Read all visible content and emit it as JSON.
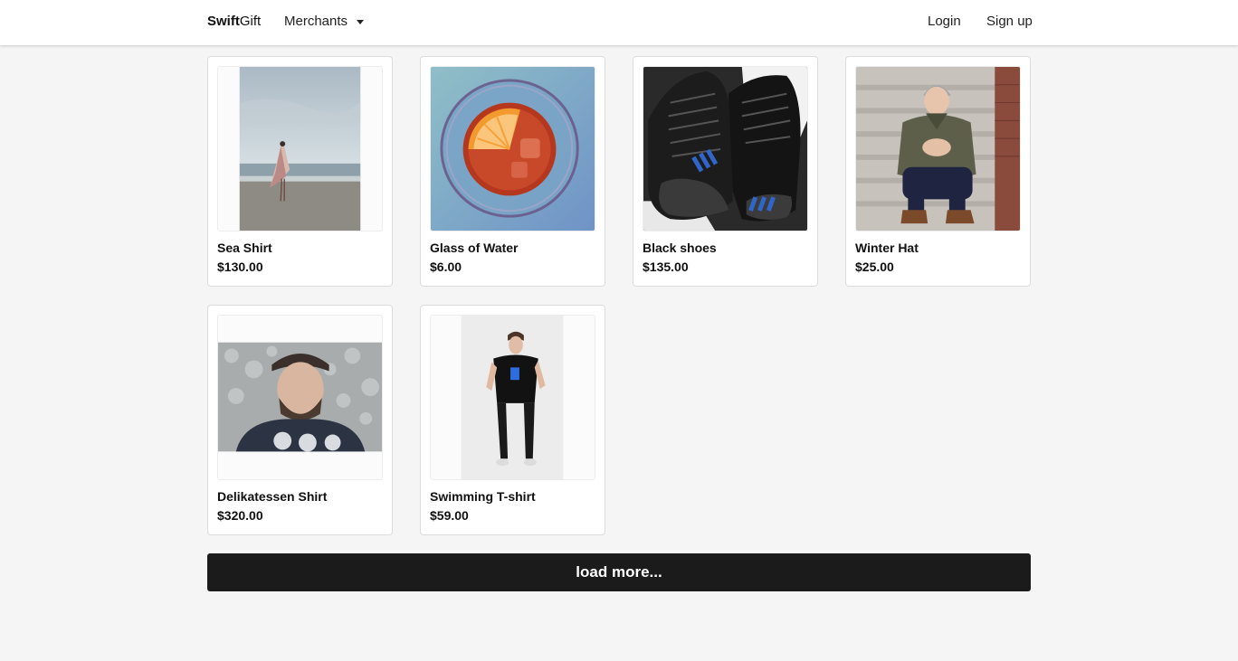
{
  "navbar": {
    "brand_bold": "Swift",
    "brand_rest": "Gift",
    "merchants_label": "Merchants",
    "login_label": "Login",
    "signup_label": "Sign up"
  },
  "products": [
    {
      "name": "Sea Shirt",
      "price": "$130.00"
    },
    {
      "name": "Glass of Water",
      "price": "$6.00"
    },
    {
      "name": "Black shoes",
      "price": "$135.00"
    },
    {
      "name": "Winter Hat",
      "price": "$25.00"
    },
    {
      "name": "Delikatessen Shirt",
      "price": "$320.00"
    },
    {
      "name": "Swimming T-shirt",
      "price": "$59.00"
    }
  ],
  "load_more_label": "load more...",
  "colors": {
    "background": "#f5f5f5",
    "navbar": "#ffffff",
    "load_more_button": "#1b1b1b",
    "text": "#111111"
  }
}
